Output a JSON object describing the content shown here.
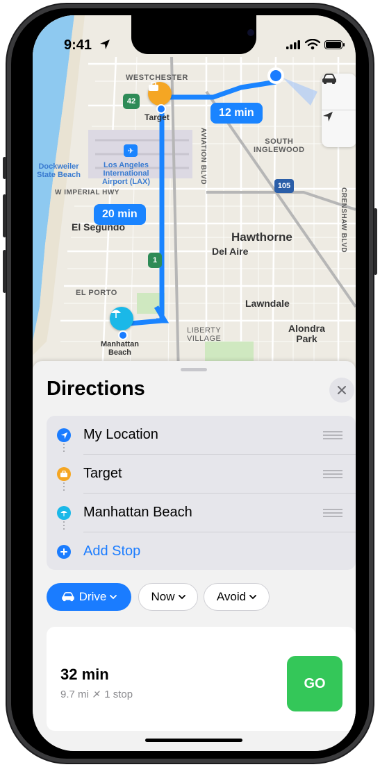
{
  "status": {
    "time": "9:41"
  },
  "map": {
    "labels": {
      "westchester": "WESTCHESTER",
      "target_label": "Target",
      "south_inglewood": "SOUTH\nINGLEWOOD",
      "aviation_blvd": "AVIATION BLVD",
      "dockweiler": "Dockweiler\nState Beach",
      "lax": "Los Angeles\nInternational\nAirport (LAX)",
      "imperial_hwy": "W IMPERIAL HWY",
      "el_segundo": "El Segundo",
      "hawthorne": "Hawthorne",
      "del_aire": "Del Aire",
      "crenshaw_blvd": "CRENSHAW BLVD",
      "el_porto": "EL PORTO",
      "lawndale": "Lawndale",
      "liberty_village": "LIBERTY\nVILLAGE",
      "alondra_park": "Alondra\nPark",
      "manhattan_beach": "Manhattan\nBeach",
      "shield_42": "42",
      "shield_105": "105",
      "shield_1": "1"
    },
    "route_times": {
      "first": "12 min",
      "second": "20 min"
    },
    "controls": {
      "mode_icon": "car-icon",
      "locate_icon": "location-arrow-icon"
    }
  },
  "directions": {
    "title": "Directions",
    "stops": [
      {
        "label": "My Location",
        "icon": "location-arrow-icon",
        "color": "#1a7cff"
      },
      {
        "label": "Target",
        "icon": "briefcase-icon",
        "color": "#f5a623"
      },
      {
        "label": "Manhattan Beach",
        "icon": "beach-umbrella-icon",
        "color": "#1ab8e8"
      }
    ],
    "add_stop": "Add Stop",
    "chips": {
      "drive": "Drive",
      "now": "Now",
      "avoid": "Avoid"
    },
    "route": {
      "time": "32 min",
      "distance": "9.7 mi",
      "stops": "1 stop",
      "go": "GO"
    }
  },
  "colors": {
    "accent": "#1a7cff",
    "go": "#34c759",
    "route": "#1a84ff"
  }
}
